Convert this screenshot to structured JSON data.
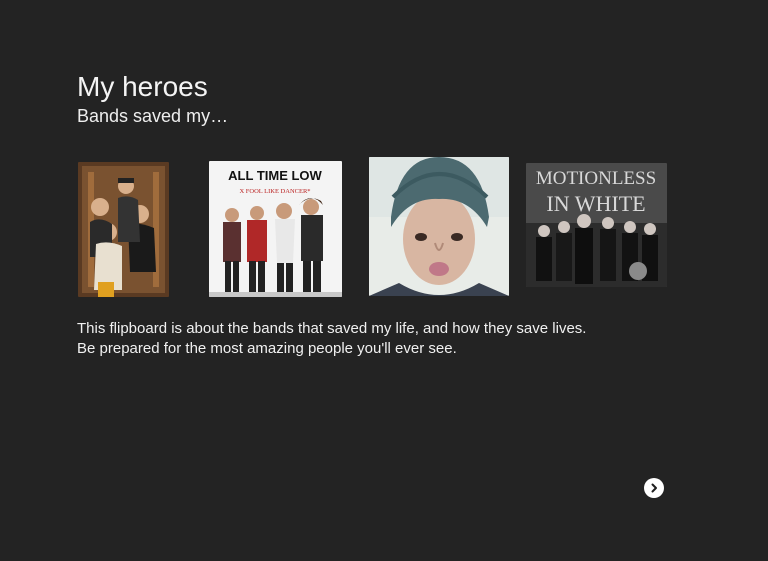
{
  "board": {
    "title": "My heroes",
    "subtitle": "Bands saved my…",
    "description": "This flipboard is about the bands that saved my life, and how they save lives. Be prepared for the most amazing people you'll ever see."
  },
  "thumbnails": [
    {
      "name": "band-photo-group",
      "text": ""
    },
    {
      "name": "all-time-low-cover",
      "line1": "ALL TIME LOW",
      "line2": "X FOOL LIKE DANCER*"
    },
    {
      "name": "singer-selfie",
      "text": ""
    },
    {
      "name": "motionless-in-white-cover",
      "line1": "MOTIONLESS",
      "line2": "IN WHITE"
    }
  ],
  "navigation": {
    "next_icon": "chevron-right-icon"
  },
  "colors": {
    "background": "#232323",
    "text": "#f2f2f2"
  }
}
